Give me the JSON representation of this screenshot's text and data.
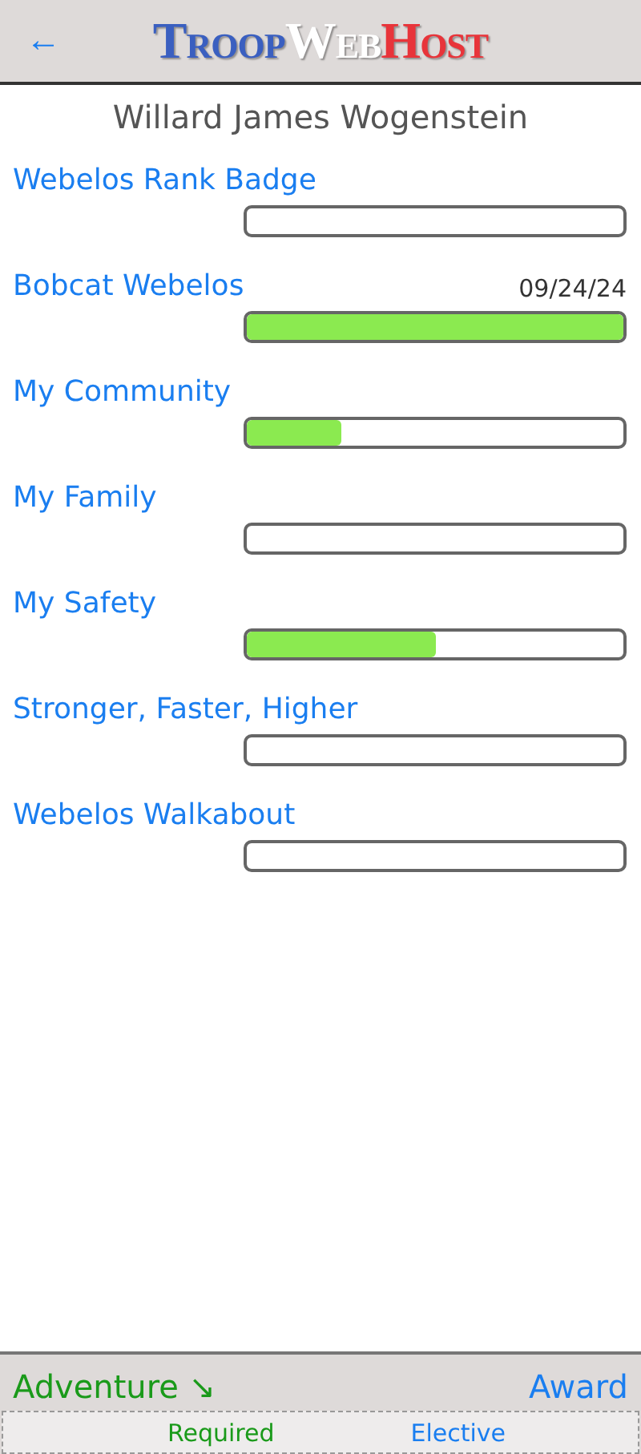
{
  "header": {
    "back": "←",
    "logo": [
      {
        "text": "Troop",
        "color": "#3a5fc0"
      },
      {
        "text": "Web",
        "color": "#ffffff"
      },
      {
        "text": "Host",
        "color": "#e8343a"
      }
    ]
  },
  "scout_name": "Willard James Wogenstein",
  "adventures": [
    {
      "name": "Webelos Rank Badge"
    },
    {
      "name": "Bobcat Webelos",
      "date": "09/24/24",
      "level": 1
    },
    {
      "name": "My Community",
      "level": 0.25
    },
    {
      "name": "My Family"
    },
    {
      "name": "My Safety",
      "level": 0.5
    },
    {
      "name": "Stronger, Faster, Higher"
    },
    {
      "name": "Webelos Walkabout"
    }
  ],
  "footer": {
    "tabs": [
      {
        "label": "Adventure",
        "arrow": "↘",
        "selected": true
      },
      {
        "label": "Award",
        "selected": false
      }
    ],
    "filters": [
      {
        "label": "Required",
        "selected": true
      },
      {
        "label": "Elective",
        "selected": false
      }
    ]
  }
}
